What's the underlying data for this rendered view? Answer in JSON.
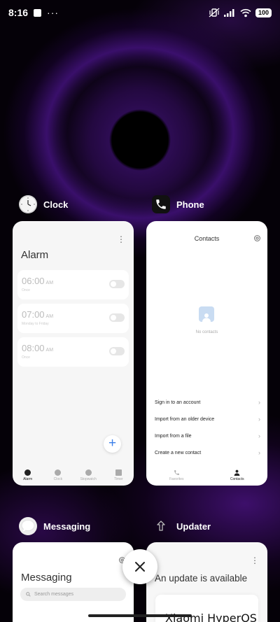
{
  "status_bar": {
    "time": "8:16",
    "dots": "···",
    "battery": "100"
  },
  "apps": {
    "clock": {
      "name": "Clock",
      "screen_title": "Alarm",
      "alarms": [
        {
          "time": "06:00",
          "ampm": "AM",
          "sub": "Once"
        },
        {
          "time": "07:00",
          "ampm": "AM",
          "sub": "Monday to Friday"
        },
        {
          "time": "08:00",
          "ampm": "AM",
          "sub": "Once"
        }
      ],
      "fab_label": "+",
      "nav": [
        {
          "label": "Alarm",
          "active": true
        },
        {
          "label": "Clock",
          "active": false
        },
        {
          "label": "Stopwatch",
          "active": false
        },
        {
          "label": "Timer",
          "active": false
        }
      ]
    },
    "phone": {
      "name": "Phone",
      "screen_title": "Contacts",
      "empty_text": "No contacts",
      "links": [
        "Sign in to an account",
        "Import from an older device",
        "Import from a file",
        "Create a new contact"
      ],
      "nav": [
        {
          "label": "Favorites",
          "active": false
        },
        {
          "label": "Contacts",
          "active": true
        }
      ]
    },
    "messaging": {
      "name": "Messaging",
      "screen_title": "Messaging",
      "search_placeholder": "Search messages"
    },
    "updater": {
      "name": "Updater",
      "screen_title": "An update is available",
      "brand_text": "Xiaomi HyperOS"
    }
  },
  "colors": {
    "accent_blue": "#3a7ee8",
    "wallpaper_purple": "#4b1488"
  }
}
